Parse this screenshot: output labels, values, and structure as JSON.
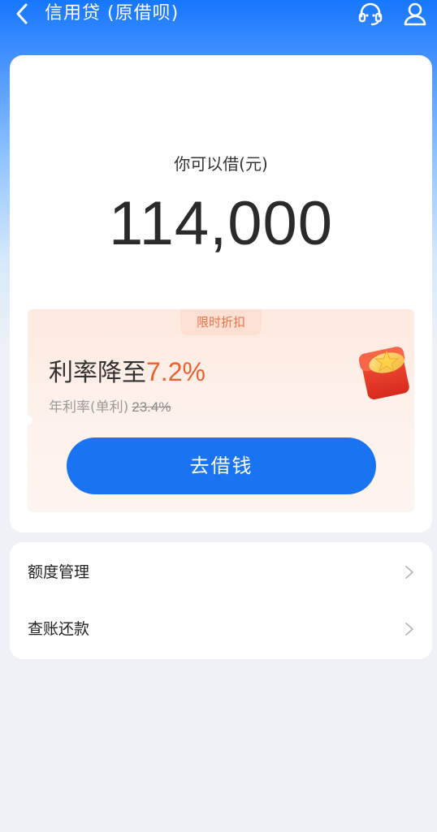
{
  "header": {
    "title": "信用贷 (原借呗)",
    "back_icon": "chevron-left-icon",
    "service_icon": "headset-icon",
    "user_icon": "user-icon"
  },
  "credit": {
    "label": "你可以借(元)",
    "amount": "114,000"
  },
  "promo": {
    "tag": "限时折扣",
    "rate_prefix": "利率降至",
    "rate_value": "7.2%",
    "original_prefix": "年利率(单利)",
    "original_rate": "23.4%",
    "button_label": "去借钱",
    "gift_icon": "red-envelope-icon"
  },
  "menu": {
    "items": [
      {
        "label": "额度管理",
        "icon": "chevron-right-icon"
      },
      {
        "label": "查账还款",
        "icon": "chevron-right-icon"
      }
    ]
  },
  "colors": {
    "primary": "#1a74f2",
    "header_blue": "#1677ff",
    "accent_orange": "#ef5f30",
    "background": "#eff1f6"
  }
}
